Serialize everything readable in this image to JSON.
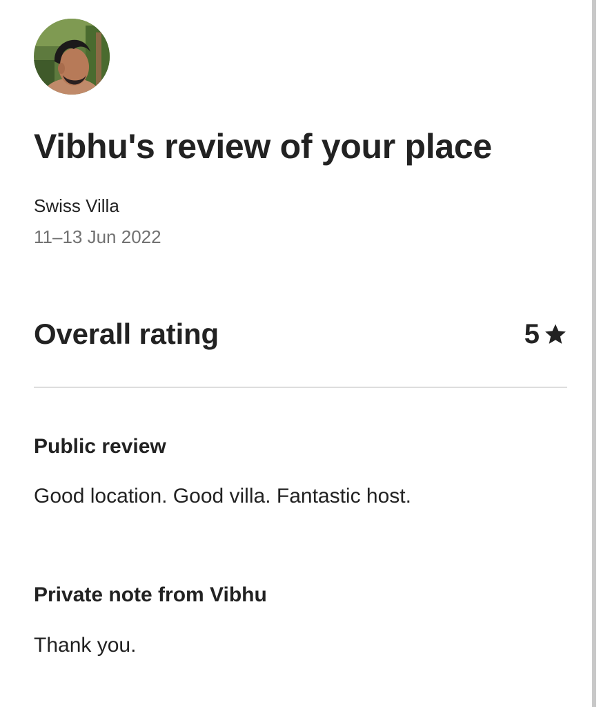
{
  "reviewer": {
    "avatar_alt": "Vibhu profile photo"
  },
  "header": {
    "title": "Vibhu's review of your place"
  },
  "stay": {
    "listing_name": "Swiss Villa",
    "dates": "11–13 Jun 2022"
  },
  "overall_rating": {
    "label": "Overall rating",
    "value": "5",
    "icon": "star-icon"
  },
  "public_review": {
    "heading": "Public review",
    "text": "Good location. Good villa. Fantastic host."
  },
  "private_note": {
    "heading": "Private note from Vibhu",
    "text": "Thank you."
  },
  "colors": {
    "text_primary": "#222222",
    "text_secondary": "#717171",
    "divider": "#dddddd",
    "scrollbar": "#c8c8c8"
  }
}
